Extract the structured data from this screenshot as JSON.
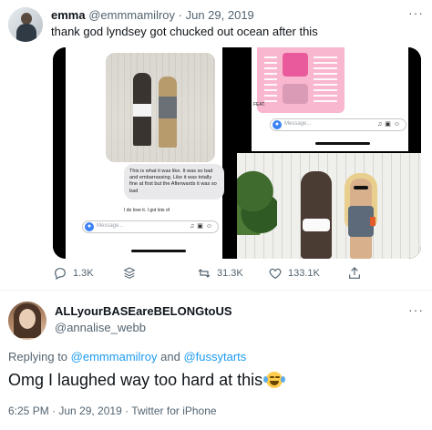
{
  "tweet": {
    "display_name": "emma",
    "handle": "@emmmamilroy",
    "separator": "·",
    "date": "Jun 29, 2019",
    "text": "thank god lyndsey got chucked out ocean after this",
    "more_label": "···",
    "media": {
      "left_bubble_text": "This is what it was like. It was so bad and embarrassing. Like it was totally fine at first but the Afterwards it was so bad",
      "left_bubble_cutoff": "I do love it. I got lots of",
      "message_placeholder": "Message...",
      "feat_label": "FEAT."
    },
    "actions": {
      "replies": "1.3K",
      "retweets": "31.3K",
      "likes": "133.1K"
    }
  },
  "reply": {
    "display_name": "ALLyourBASEareBELONGtoUS",
    "handle": "@annalise_webb",
    "more_label": "···",
    "replying_prefix": "Replying to",
    "replying_to_1": "@emmmamilroy",
    "replying_and": "and",
    "replying_to_2": "@fussytarts",
    "text": "Omg I laughed way too hard at this",
    "emoji": "face-with-tears-of-joy",
    "timestamp": "6:25 PM · Jun 29, 2019 · Twitter for iPhone"
  },
  "colors": {
    "text_primary": "#0f1419",
    "text_secondary": "#536471",
    "link": "#1d9bf0",
    "divider": "#eff3f4"
  }
}
